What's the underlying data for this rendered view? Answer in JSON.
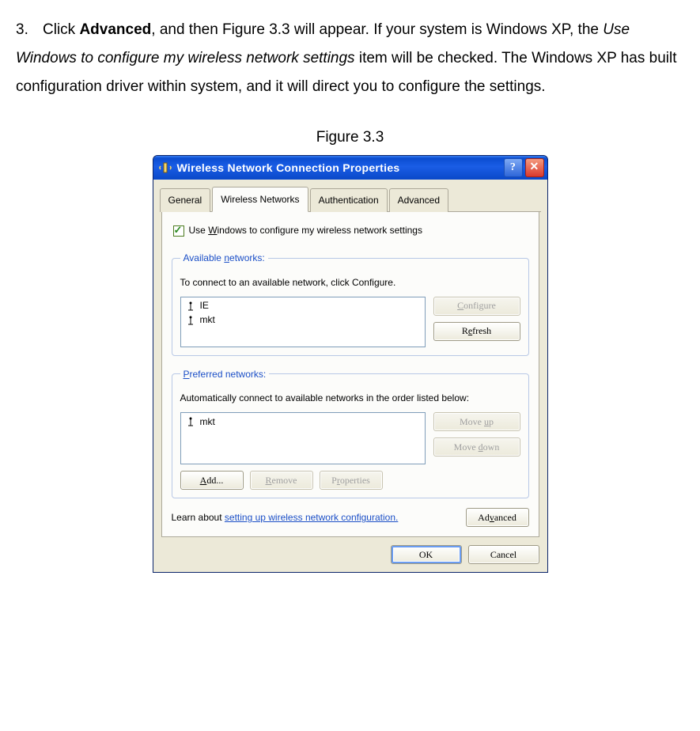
{
  "instruction": {
    "number": "3.",
    "pre": "Click ",
    "bold": "Advanced",
    "mid1": ", and then Figure 3.3 will appear. If your system is Windows XP, the ",
    "italic": "Use Windows to configure my wireless network settings",
    "mid2": " item will be checked. The Windows XP has built configuration driver within system, and it will direct you to configure the settings."
  },
  "figure_caption": "Figure 3.3",
  "dialog": {
    "title": "Wireless Network Connection Properties",
    "help_symbol": "?",
    "close_symbol": "✕",
    "tabs": {
      "general": "General",
      "wireless": "Wireless Networks",
      "auth": "Authentication",
      "advanced": "Advanced"
    },
    "checkbox_pre": "Use ",
    "checkbox_ul": "W",
    "checkbox_post": "indows to configure my wireless network settings",
    "available": {
      "legend_pre": "Available ",
      "legend_ul": "n",
      "legend_post": "etworks:",
      "desc": "To connect to an available network, click Configure.",
      "items": [
        "IE",
        "mkt"
      ],
      "configure_pre": "",
      "configure_ul": "C",
      "configure_post": "onfigure",
      "refresh_pre": "R",
      "refresh_ul": "e",
      "refresh_post": "fresh"
    },
    "preferred": {
      "legend_ul": "P",
      "legend_post": "referred networks:",
      "desc": "Automatically connect to available networks in the order listed below:",
      "items": [
        "mkt"
      ],
      "moveup_pre": "Move ",
      "moveup_ul": "u",
      "moveup_post": "p",
      "movedown_pre": "Move ",
      "movedown_ul": "d",
      "movedown_post": "own",
      "add_ul": "A",
      "add_post": "dd...",
      "remove_ul": "R",
      "remove_post": "emove",
      "props_pre": "P",
      "props_ul": "r",
      "props_post": "operties"
    },
    "learn_pre": "Learn about ",
    "learn_link": "setting up wireless network configuration.",
    "advanced_pre": "Ad",
    "advanced_ul": "v",
    "advanced_post": "anced",
    "ok": "OK",
    "cancel": "Cancel"
  }
}
